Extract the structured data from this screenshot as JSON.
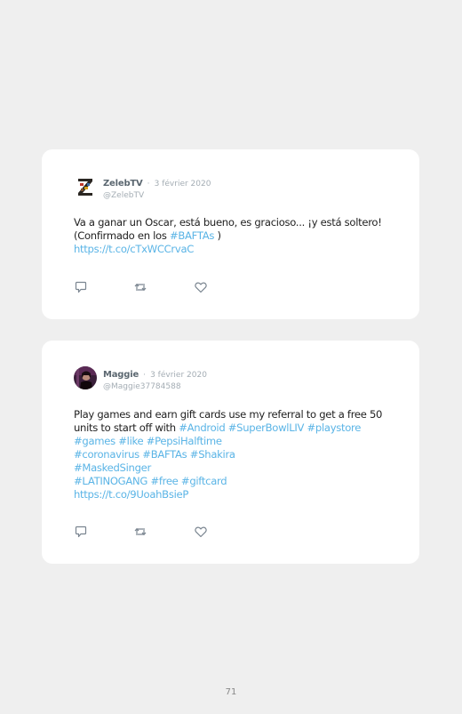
{
  "tweets": [
    {
      "display_name": "ZelebTV",
      "separator": "·",
      "date": "3 février 2020",
      "handle": "@ZelebTV",
      "text_parts": [
        {
          "text": "Va a ganar un Oscar, está bueno, es gracioso... ¡y está soltero! (Confirmado en los ",
          "link": false
        },
        {
          "text": "#BAFTAs",
          "link": true
        },
        {
          "text": " )",
          "link": false
        },
        {
          "text": "https://t.co/cTxWCCrvaC",
          "link": true,
          "block": true
        }
      ],
      "icons": [
        "reply-icon",
        "retweet-icon",
        "like-icon"
      ]
    },
    {
      "display_name": "Maggie",
      "separator": "·",
      "date": "3 février 2020",
      "handle": "@Maggie37784588",
      "text_parts": [
        {
          "text": "Play games and earn gift cards use my referral to get a free 50 units to start off with ",
          "link": false
        },
        {
          "text": "#Android",
          "link": true
        },
        {
          "text": " ",
          "link": false
        },
        {
          "text": "#SuperBowlLIV",
          "link": true
        },
        {
          "text": " ",
          "link": false
        },
        {
          "text": "#playstore",
          "link": true
        },
        {
          "text": "#games",
          "link": true,
          "block": true
        },
        {
          "text": " ",
          "link": false
        },
        {
          "text": "#like",
          "link": true
        },
        {
          "text": " ",
          "link": false
        },
        {
          "text": "#PepsiHalftime",
          "link": true
        },
        {
          "text": "#coronavirus",
          "link": true,
          "block": true
        },
        {
          "text": " ",
          "link": false
        },
        {
          "text": "#BAFTAs",
          "link": true
        },
        {
          "text": " ",
          "link": false
        },
        {
          "text": "#Shakira",
          "link": true
        },
        {
          "text": "#MaskedSinger",
          "link": true,
          "block": true
        },
        {
          "text": "#LATINOGANG",
          "link": true,
          "block": true
        },
        {
          "text": " ",
          "link": false
        },
        {
          "text": "#free",
          "link": true
        },
        {
          "text": " ",
          "link": false
        },
        {
          "text": "#giftcard",
          "link": true
        },
        {
          "text": "https://t.co/9UoahBsieP",
          "link": true,
          "block": true
        }
      ],
      "icons": [
        "reply-icon",
        "retweet-icon",
        "like-icon"
      ]
    }
  ],
  "page": {
    "number": "71"
  },
  "colors": {
    "background": "#efefef",
    "card": "#ffffff",
    "link": "#5ab4e6",
    "meta": "#a4adb4",
    "name": "#5b6770",
    "icon": "#7a8590"
  }
}
